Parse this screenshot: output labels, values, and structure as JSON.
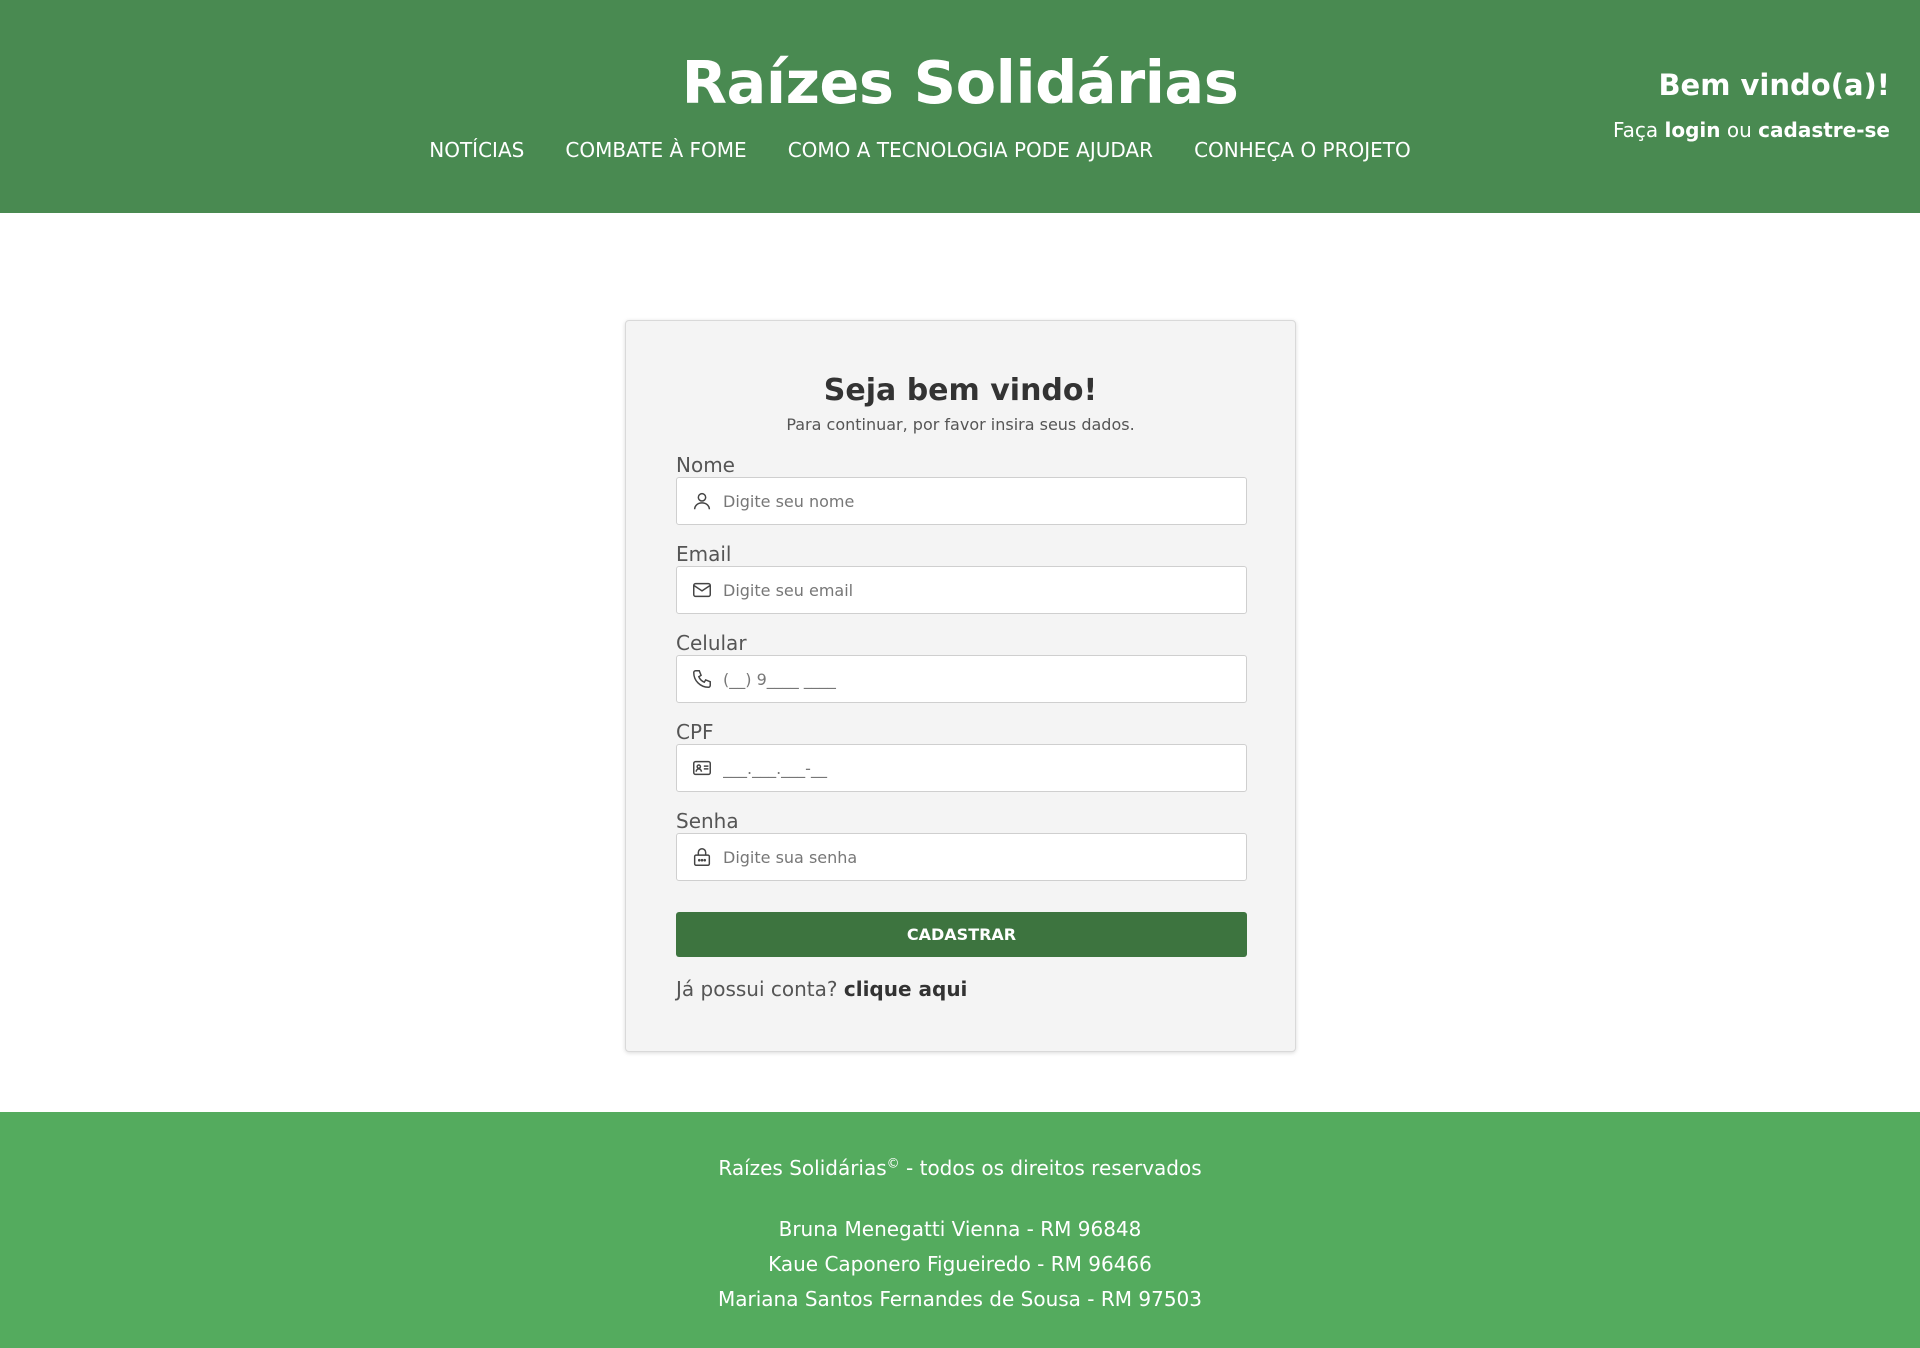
{
  "header": {
    "site_title": "Raízes Solidárias",
    "nav": [
      "NOTÍCIAS",
      "COMBATE À FOME",
      "COMO A TECNOLOGIA PODE AJUDAR",
      "CONHEÇA O PROJETO"
    ],
    "welcome_title": "Bem vindo(a)!",
    "welcome_prefix": "Faça",
    "login_link": "login",
    "welcome_or": "ou",
    "signup_link": "cadastre-se"
  },
  "form": {
    "title": "Seja bem vindo!",
    "subtitle": "Para continuar, por favor insira seus dados.",
    "fields": [
      {
        "label": "Nome",
        "placeholder": "Digite seu nome",
        "icon": "user-icon"
      },
      {
        "label": "Email",
        "placeholder": "Digite seu email",
        "icon": "mail-icon"
      },
      {
        "label": "Celular",
        "placeholder": "(__) 9____ ____",
        "icon": "phone-icon"
      },
      {
        "label": "CPF",
        "placeholder": "___.___.___-__",
        "icon": "id-card-icon"
      },
      {
        "label": "Senha",
        "placeholder": "Digite sua senha",
        "icon": "lock-icon"
      }
    ],
    "submit_label": "CADASTRAR",
    "has_account_text": "Já possui conta?",
    "click_here": "clique aqui"
  },
  "footer": {
    "brand": "Raízes Solidárias",
    "copyright_mark": "©",
    "rights": "- todos os direitos reservados",
    "authors": [
      "Bruna Menegatti Vienna - RM 96848",
      "Kaue Caponero Figueiredo - RM 96466",
      "Mariana Santos Fernandes de Sousa - RM 97503"
    ]
  },
  "colors": {
    "header_bg": "#498a51",
    "footer_bg": "#54ab5e",
    "button_bg": "#3d743f"
  }
}
